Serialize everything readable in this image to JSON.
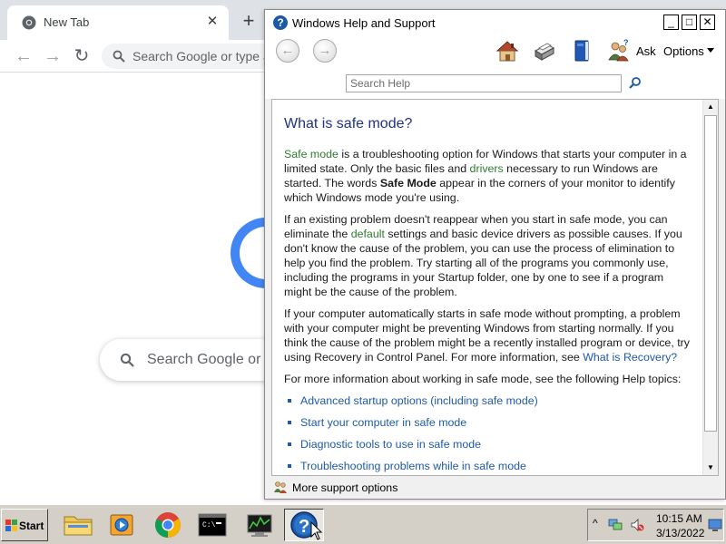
{
  "chrome": {
    "tab_title": "New Tab",
    "tab_close": "✕",
    "new_tab": "+",
    "back": "←",
    "forward": "→",
    "reload": "↻",
    "omnibox_placeholder": "Search Google or type a URL",
    "ntp_search_placeholder": "Search Google or type a URL"
  },
  "help_window": {
    "title": "Windows Help and Support",
    "controls": {
      "minimize": "_",
      "maximize": "□",
      "close": "✕"
    },
    "toolbar": {
      "back": "←",
      "forward": "→",
      "ask_label": "Ask",
      "options_label": "Options"
    },
    "search_placeholder": "Search Help",
    "article": {
      "heading": "What is safe mode?",
      "p1": {
        "link_safe_mode": "Safe mode",
        "t1": " is a troubleshooting option for Windows that starts your computer in a limited state. Only the basic files and ",
        "link_drivers": "drivers",
        "t2": " necessary to run Windows are started. The words ",
        "bold": "Safe Mode",
        "t3": " appear in the corners of your monitor to identify which Windows mode you're using."
      },
      "p2": {
        "t1": "If an existing problem doesn't reappear when you start in safe mode, you can eliminate the ",
        "link_default": "default",
        "t2": " settings and basic device drivers as possible causes. If you don't know the cause of the problem, you can use the process of elimination to help you find the problem. Try starting all of the programs you commonly use, including the programs in your Startup folder, one by one to see if a program might be the cause of the problem."
      },
      "p3": {
        "t1": "If your computer automatically starts in safe mode without prompting, a problem with your computer might be preventing Windows from starting normally. If you think the cause of the problem might be a recently installed program or device, try using Recovery in Control Panel. For more information, see ",
        "link_recovery": "What is Recovery?"
      },
      "p4": "For more information about working in safe mode, see the following Help topics:",
      "topics": [
        "Advanced startup options (including safe mode)",
        "Start your computer in safe mode",
        "Diagnostic tools to use in safe mode",
        "Troubleshooting problems while in safe mode"
      ]
    },
    "support_link": "More support options"
  },
  "taskbar": {
    "start_label": "Start",
    "tray_expand": "^",
    "clock_time": "10:15 AM",
    "clock_date": "3/13/2022"
  },
  "colors": {
    "help_heading": "#1e3287",
    "green_link": "#2e7d32",
    "blue_link": "#1f5aa6",
    "taskbar_bg": "#d4d0c8",
    "chrome_tabstrip": "#dee1e6",
    "google_blue": "#4285f4"
  },
  "icons": {
    "chrome_favicon": "chrome-logo-icon",
    "home": "house-icon",
    "print": "printer-icon",
    "browse": "book-icon",
    "ask": "people-question-icon",
    "search": "magnifier-icon",
    "support": "people-icon"
  }
}
